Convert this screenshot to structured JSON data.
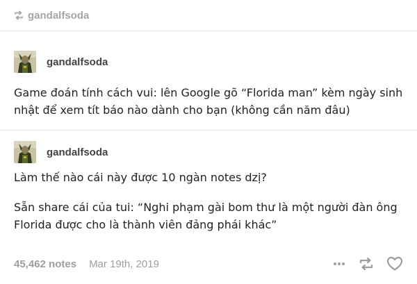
{
  "reblog": {
    "icon": "reblog-icon",
    "username": "gandalfsoda"
  },
  "posts": [
    {
      "avatar": "avatar-icon",
      "username": "gandalfsoda",
      "text": "Game đoán tính cách vui: lên Google gõ “Florida man” kèm ngày sinh nhật để xem tít báo nào dành cho bạn (không cần năm đâu)"
    },
    {
      "avatar": "avatar-icon",
      "username": "gandalfsoda",
      "paragraphs": [
        "Làm thế nào cái này được 10 ngàn notes dzị?",
        "Sẵn share cái của tui: “Nghi phạm gài bom thư là một người đàn ông Florida được cho là thành viên đảng phái khác”"
      ]
    }
  ],
  "footer": {
    "notes": "45,462 notes",
    "date": "Mar 19th, 2019",
    "icons": [
      "more-icon",
      "reblog-icon",
      "like-heart-icon"
    ]
  },
  "colors": {
    "muted": "#9e9e9e",
    "divider": "#e6e6e6",
    "text": "#222222"
  }
}
